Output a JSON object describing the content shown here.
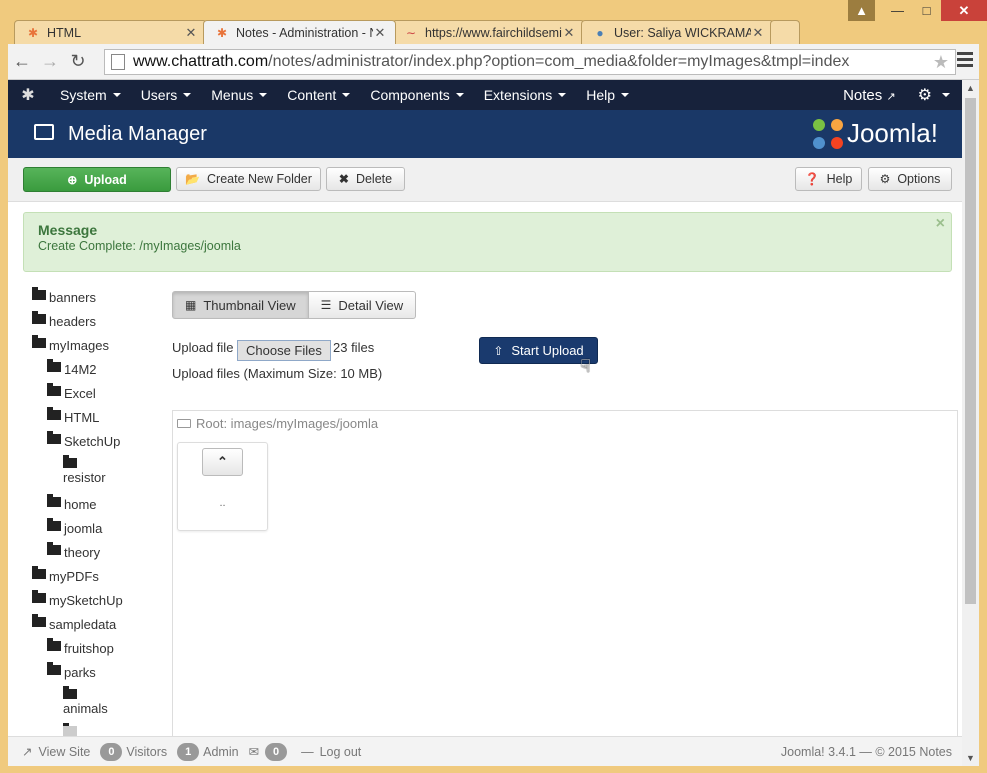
{
  "browser": {
    "tabs": [
      {
        "title": "HTML",
        "icon": "joomla-icon"
      },
      {
        "title": "Notes - Administration - N",
        "icon": "joomla-icon"
      },
      {
        "title": "https://www.fairchildsemi.",
        "icon": "fairchild-icon"
      },
      {
        "title": "User: Saliya WICKRAMASIN",
        "icon": "globe-icon"
      }
    ],
    "url_domain": "www.chattrath.com",
    "url_rest": "/notes/administrator/index.php?option=com_media&folder=myImages&tmpl=index"
  },
  "nav": {
    "menus": [
      "System",
      "Users",
      "Menus",
      "Content",
      "Components",
      "Extensions",
      "Help"
    ],
    "site_link": "Notes"
  },
  "header": {
    "title": "Media Manager",
    "brand": "Joomla!"
  },
  "toolbar": {
    "upload": "Upload",
    "new_folder": "Create New Folder",
    "delete": "Delete",
    "help": "Help",
    "options": "Options"
  },
  "message": {
    "heading": "Message",
    "text": "Create Complete: /myImages/joomla"
  },
  "tree": [
    {
      "label": "banners",
      "depth": 0
    },
    {
      "label": "headers",
      "depth": 0
    },
    {
      "label": "myImages",
      "depth": 0
    },
    {
      "label": "14M2",
      "depth": 1
    },
    {
      "label": "Excel",
      "depth": 1
    },
    {
      "label": "HTML",
      "depth": 1
    },
    {
      "label": "SketchUp",
      "depth": 1
    },
    {
      "label": "resistor",
      "depth": 2
    },
    {
      "label": "home",
      "depth": 1
    },
    {
      "label": "joomla",
      "depth": 1
    },
    {
      "label": "theory",
      "depth": 1
    },
    {
      "label": "myPDFs",
      "depth": 0
    },
    {
      "label": "mySketchUp",
      "depth": 0
    },
    {
      "label": "sampledata",
      "depth": 0
    },
    {
      "label": "fruitshop",
      "depth": 1
    },
    {
      "label": "parks",
      "depth": 1
    },
    {
      "label": "animals",
      "depth": 2
    }
  ],
  "views": {
    "thumbnail": "Thumbnail View",
    "detail": "Detail View"
  },
  "upload": {
    "label": "Upload file",
    "choose": "Choose Files",
    "count": "23 files",
    "max": "Upload files (Maximum Size: 10 MB)",
    "start": "Start Upload"
  },
  "root": {
    "label": "Root: images/myImages/joomla",
    "up_dots": ".."
  },
  "footer": {
    "view_site": "View Site",
    "visitors_count": "0",
    "visitors": "Visitors",
    "admin_count": "1",
    "admin": "Admin",
    "msg_count": "0",
    "logout": "Log out",
    "copyright": "Joomla! 3.4.1  —  © 2015 Notes"
  }
}
